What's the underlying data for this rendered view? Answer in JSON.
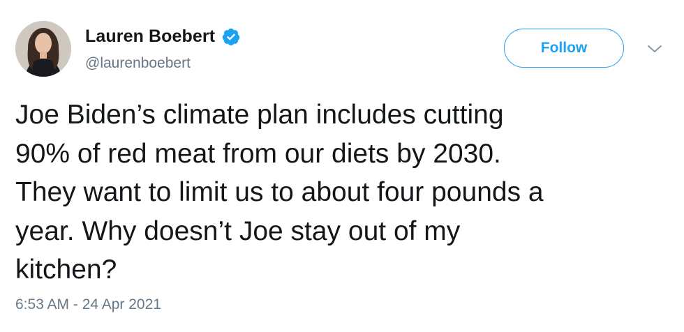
{
  "author": {
    "display_name": "Lauren Boebert",
    "handle": "@laurenboebert",
    "verified": true
  },
  "follow_button": {
    "label": "Follow"
  },
  "icons": {
    "verified": "verified-badge-icon",
    "menu": "chevron-down-icon"
  },
  "tweet": {
    "text": "Joe Biden’s climate plan includes cutting\n90% of red meat from our diets by 2030.\nThey want to limit us to about four pounds a\nyear. Why doesn’t Joe stay out of my\nkitchen?",
    "timestamp": "6:53 AM - 24 Apr 2021"
  },
  "colors": {
    "accent": "#1da1f2",
    "text": "#14171a",
    "secondary_text": "#657786"
  }
}
